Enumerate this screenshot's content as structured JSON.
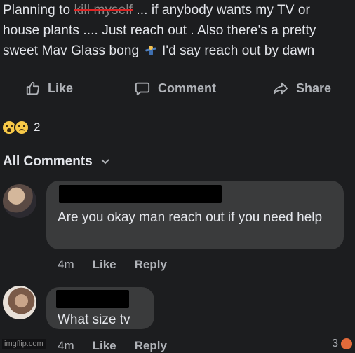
{
  "post": {
    "line1_pre": "Planning to",
    "line1_redacted": "kill myself",
    "line1_post": "... if anybody wants my TV or",
    "line2": "house plants .... Just reach out . Also there's a pretty",
    "line3_pre": "sweet Mav Glass bong",
    "line3_emoji": "person-shrugging-icon",
    "line3_post": "I'd say reach out by dawn"
  },
  "actions": {
    "like": "Like",
    "comment": "Comment",
    "share": "Share"
  },
  "reactions": {
    "icons": [
      "wow-reaction-icon",
      "sad-reaction-icon"
    ],
    "count": "2"
  },
  "comments_header": {
    "label": "All Comments"
  },
  "comments": [
    {
      "text": "Are you okay man reach out if you need help",
      "time": "4m",
      "like": "Like",
      "reply": "Reply"
    },
    {
      "text": "What size tv",
      "time": "4m",
      "like": "Like",
      "reply": "Reply",
      "reaction_count": "3"
    }
  ],
  "watermark": "imgflip.com",
  "colors": {
    "background": "#1c1d1f",
    "bubble": "#3a3b3c",
    "text": "#e4e6eb",
    "muted": "#b0b3b8",
    "strike": "#e02424"
  }
}
